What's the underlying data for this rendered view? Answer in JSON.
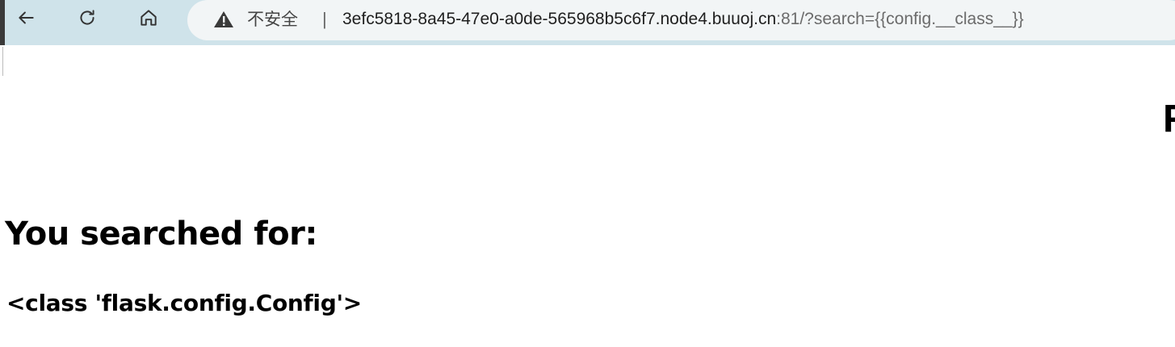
{
  "browser": {
    "security_label": "不安全",
    "separator": "|",
    "url_host": "3efc5818-8a45-47e0-a0de-565968b5c6f7.node4.buuoj.cn",
    "url_rest": ":81/?search={{config.__class__}}",
    "colors": {
      "toolbar": "#cfe3ea",
      "omnibox": "#f2f5f6"
    }
  },
  "page": {
    "edge_text": "F",
    "heading": "You searched for:",
    "result": "<class 'flask.config.Config'>"
  }
}
